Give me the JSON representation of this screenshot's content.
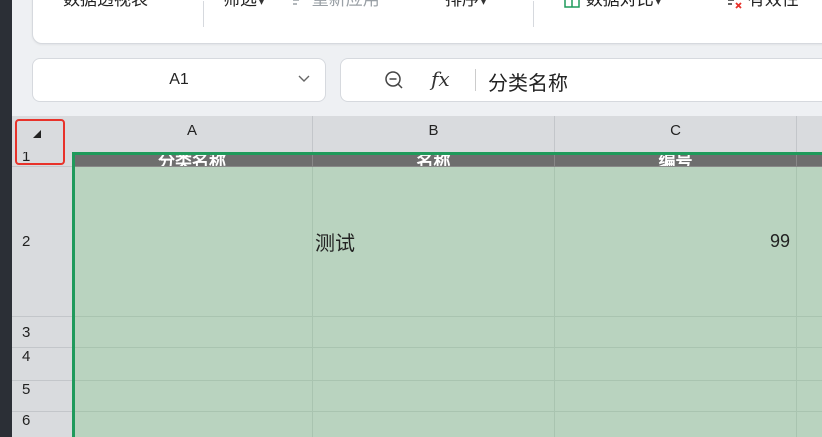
{
  "ribbon": {
    "items": [
      "数据透视表",
      "筛选",
      "重新应用",
      "排序",
      "数据对比",
      "有效性"
    ]
  },
  "name_box": {
    "value": "A1"
  },
  "formula_bar": {
    "fx_label": "fx",
    "value": "分类名称"
  },
  "columns": [
    "A",
    "B",
    "C"
  ],
  "rows": [
    "1",
    "2",
    "3",
    "4",
    "5",
    "6"
  ],
  "cells": {
    "A1": "分类名称",
    "B1": "名称",
    "C1": "编号",
    "A2": "",
    "B2": "测试",
    "C2": "99"
  },
  "colors": {
    "selection": "#1f9a5b",
    "header_fill": "#6e6e6e",
    "cell_fill": "#b9d3bf",
    "highlight": "#e8322a"
  }
}
